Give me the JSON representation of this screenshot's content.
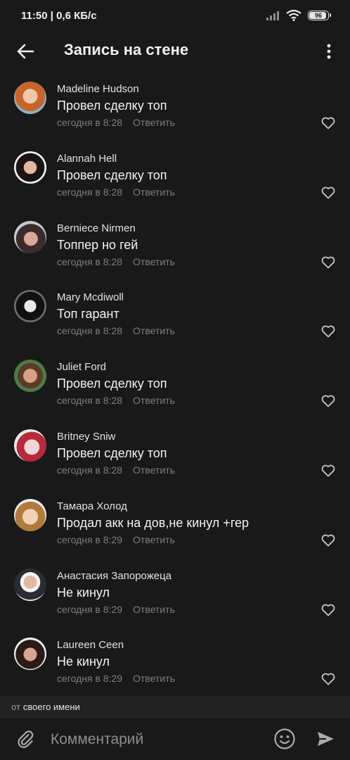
{
  "status_bar": {
    "time": "11:50",
    "speed": "0,6 КБ/с",
    "battery": "96"
  },
  "header": {
    "title": "Запись на стене"
  },
  "comments": [
    {
      "author": "Madeline Hudson",
      "text": "Провел сделку топ",
      "time": "сегодня в 8:28",
      "reply": "Ответить"
    },
    {
      "author": "Alannah Hell",
      "text": "Провел сделку топ",
      "time": "сегодня в 8:28",
      "reply": "Ответить"
    },
    {
      "author": "Berniece Nirmen",
      "text": "Топпер но гей",
      "time": "сегодня в 8:28",
      "reply": "Ответить"
    },
    {
      "author": "Mary Mcdiwoll",
      "text": "Топ гарант",
      "time": "сегодня в 8:28",
      "reply": "Ответить"
    },
    {
      "author": "Juliet Ford",
      "text": "Провел сделку топ",
      "time": "сегодня в 8:28",
      "reply": "Ответить"
    },
    {
      "author": "Britney Sniw",
      "text": "Провел сделку топ",
      "time": "сегодня в 8:28",
      "reply": "Ответить"
    },
    {
      "author": "Тамара Холод",
      "text": "Продал акк на дов,не кинул +гер",
      "time": "сегодня в 8:29",
      "reply": "Ответить"
    },
    {
      "author": "Анастасия Запорожеца",
      "text": "Не кинул",
      "time": "сегодня в 8:29",
      "reply": "Ответить"
    },
    {
      "author": "Laureen Ceen",
      "text": "Не кинул",
      "time": "сегодня в 8:29",
      "reply": "Ответить"
    }
  ],
  "from_bar": {
    "prefix": "от",
    "name": "своего имени"
  },
  "composer": {
    "placeholder": "Комментарий"
  },
  "icons": {
    "back": "back-arrow-icon",
    "menu": "more-vertical-icon",
    "like": "heart-icon",
    "attach": "paperclip-icon",
    "emoji": "emoji-icon",
    "send": "send-icon",
    "wifi": "wifi-icon",
    "signal": "signal-icon",
    "battery": "battery-icon"
  },
  "colors": {
    "background": "#19191a",
    "text": "#e1e3e6",
    "secondary": "#7c7f84",
    "from_bar": "#222224"
  }
}
